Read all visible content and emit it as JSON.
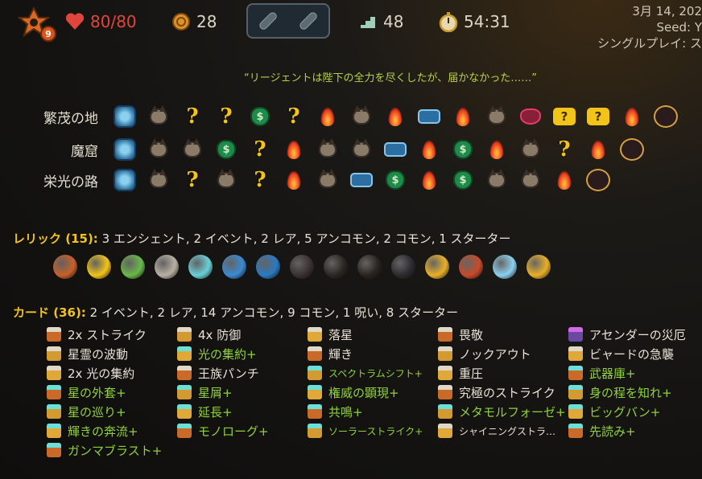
{
  "header": {
    "ascension": "9",
    "hp": "80/80",
    "gold": "28",
    "floor": "48",
    "time": "54:31",
    "date": "3月 14, 202",
    "seed": "Seed: Y",
    "mode": "シングルプレイ: ス"
  },
  "quote": "“リージェントは陛下の全力を尽くしたが、届かなかった……”",
  "acts": [
    {
      "name": "繁茂の地",
      "nodes": [
        "ancient",
        "monster",
        "unknown",
        "unknown",
        "merchant",
        "unknown",
        "rest",
        "monster",
        "rest",
        "treasure",
        "rest",
        "monster",
        "elite",
        "qgold",
        "qgold",
        "rest",
        "boss"
      ]
    },
    {
      "name": "魔窟",
      "nodes": [
        "ancient",
        "monster",
        "monster",
        "merchant",
        "unknown",
        "rest",
        "monster",
        "monster",
        "treasure",
        "rest",
        "merchant",
        "rest",
        "monster",
        "unknown",
        "rest",
        "boss"
      ]
    },
    {
      "name": "栄光の路",
      "nodes": [
        "ancient",
        "monster",
        "unknown",
        "monster",
        "unknown",
        "rest",
        "monster",
        "treasure",
        "merchant",
        "rest",
        "merchant",
        "monster",
        "monster",
        "rest",
        "boss"
      ]
    }
  ],
  "relics": {
    "label": "レリック (15):",
    "summary": "3 エンシェント, 2 イベント, 2 レア, 5 アンコモン, 2 コモン, 1 スターター",
    "colors": [
      "#c8602a",
      "#f2c419",
      "#6ab84a",
      "#b8b0a4",
      "#6ad0d8",
      "#3a8ad2",
      "#2a7ac2",
      "#3a3030",
      "#2a2622",
      "#2a2420",
      "#2c2a30",
      "#e8b028",
      "#c84a2a",
      "#8ad0f0",
      "#e8b028"
    ]
  },
  "cards_header": {
    "label": "カード (36):",
    "summary": "2 イベント, 2 レア, 14 アンコモン, 9 コモン, 1 呪い, 8 スターター"
  },
  "cards": [
    [
      "2x ストライク",
      "星霊の波動",
      "2x 光の集約",
      "星の外套+",
      "星の巡り+",
      "輝きの奔流+",
      "ガンマブラスト+"
    ],
    [
      "4x 防御",
      "光の集約+",
      "王族パンチ",
      "星屑+",
      "延長+",
      "モノローグ+"
    ],
    [
      "落星",
      "輝き",
      "スペクトラムシフト+",
      "権威の顕現+",
      "共鳴+",
      "ソーラーストライク+"
    ],
    [
      "畏敬",
      "ノックアウト",
      "重圧",
      "究極のストライク",
      "メタモルフォーゼ+",
      "シャイニングストラ…"
    ],
    [
      "アセンダーの災厄",
      "ビャードの急襲",
      "武器庫+",
      "身の程を知れ+",
      "ビッグバン+",
      "先読み+"
    ]
  ]
}
